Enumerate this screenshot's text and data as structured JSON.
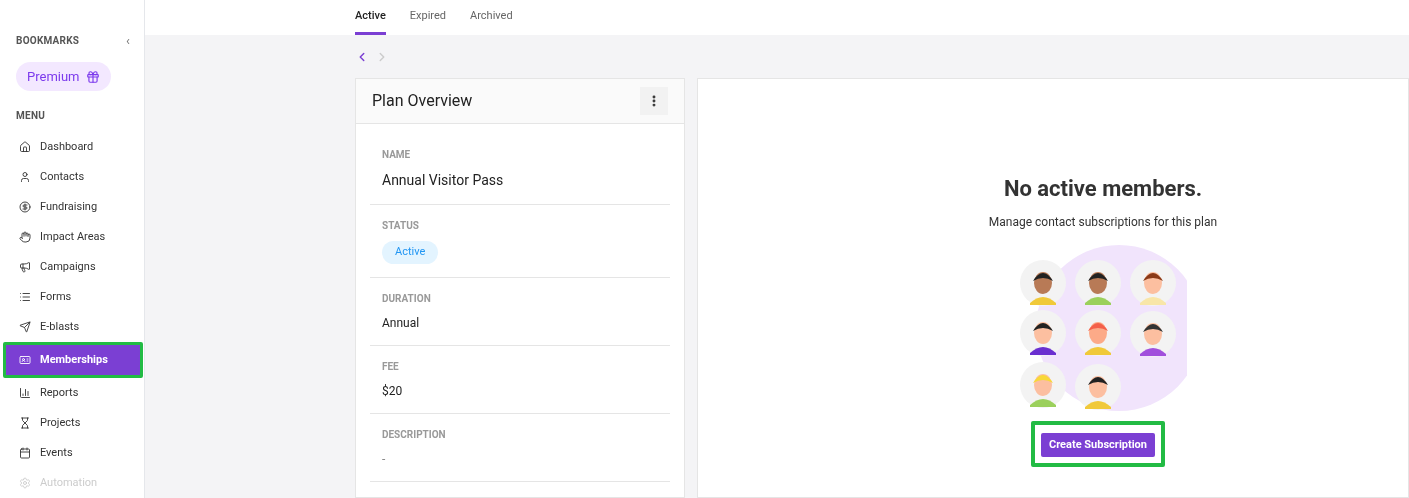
{
  "sidebar": {
    "bookmarks_label": "BOOKMARKS",
    "collapse_icon": "‹",
    "premium_button": "Premium",
    "menu_label": "MENU",
    "items": [
      {
        "label": "Dashboard",
        "selected": false,
        "disabled": false,
        "highlighted": false
      },
      {
        "label": "Contacts",
        "selected": false,
        "disabled": false,
        "highlighted": false
      },
      {
        "label": "Fundraising",
        "selected": false,
        "disabled": false,
        "highlighted": false
      },
      {
        "label": "Impact Areas",
        "selected": false,
        "disabled": false,
        "highlighted": false
      },
      {
        "label": "Campaigns",
        "selected": false,
        "disabled": false,
        "highlighted": false
      },
      {
        "label": "Forms",
        "selected": false,
        "disabled": false,
        "highlighted": false
      },
      {
        "label": "E-blasts",
        "selected": false,
        "disabled": false,
        "highlighted": false
      },
      {
        "label": "Memberships",
        "selected": true,
        "disabled": false,
        "highlighted": true
      },
      {
        "label": "Reports",
        "selected": false,
        "disabled": false,
        "highlighted": false
      },
      {
        "label": "Projects",
        "selected": false,
        "disabled": false,
        "highlighted": false
      },
      {
        "label": "Events",
        "selected": false,
        "disabled": false,
        "highlighted": false
      },
      {
        "label": "Automation",
        "selected": false,
        "disabled": true,
        "highlighted": false
      }
    ]
  },
  "tabs": [
    {
      "label": "Active",
      "selected": true
    },
    {
      "label": "Expired",
      "selected": false
    },
    {
      "label": "Archived",
      "selected": false
    }
  ],
  "pager": {
    "prev_disabled": false,
    "next_disabled": true
  },
  "plan_overview": {
    "title": "Plan Overview",
    "fields": [
      {
        "label": "NAME",
        "value": "Annual Visitor Pass",
        "kind": "title"
      },
      {
        "label": "STATUS",
        "value": "Active",
        "kind": "badge"
      },
      {
        "label": "DURATION",
        "value": "Annual",
        "kind": "text"
      },
      {
        "label": "FEE",
        "value": "$20",
        "kind": "text"
      },
      {
        "label": "DESCRIPTION",
        "value": "-",
        "kind": "empty"
      }
    ]
  },
  "members": {
    "heading": "No active members.",
    "subtitle": "Manage contact subscriptions for this plan",
    "create_button": "Create Subscription",
    "button_highlighted": true
  }
}
